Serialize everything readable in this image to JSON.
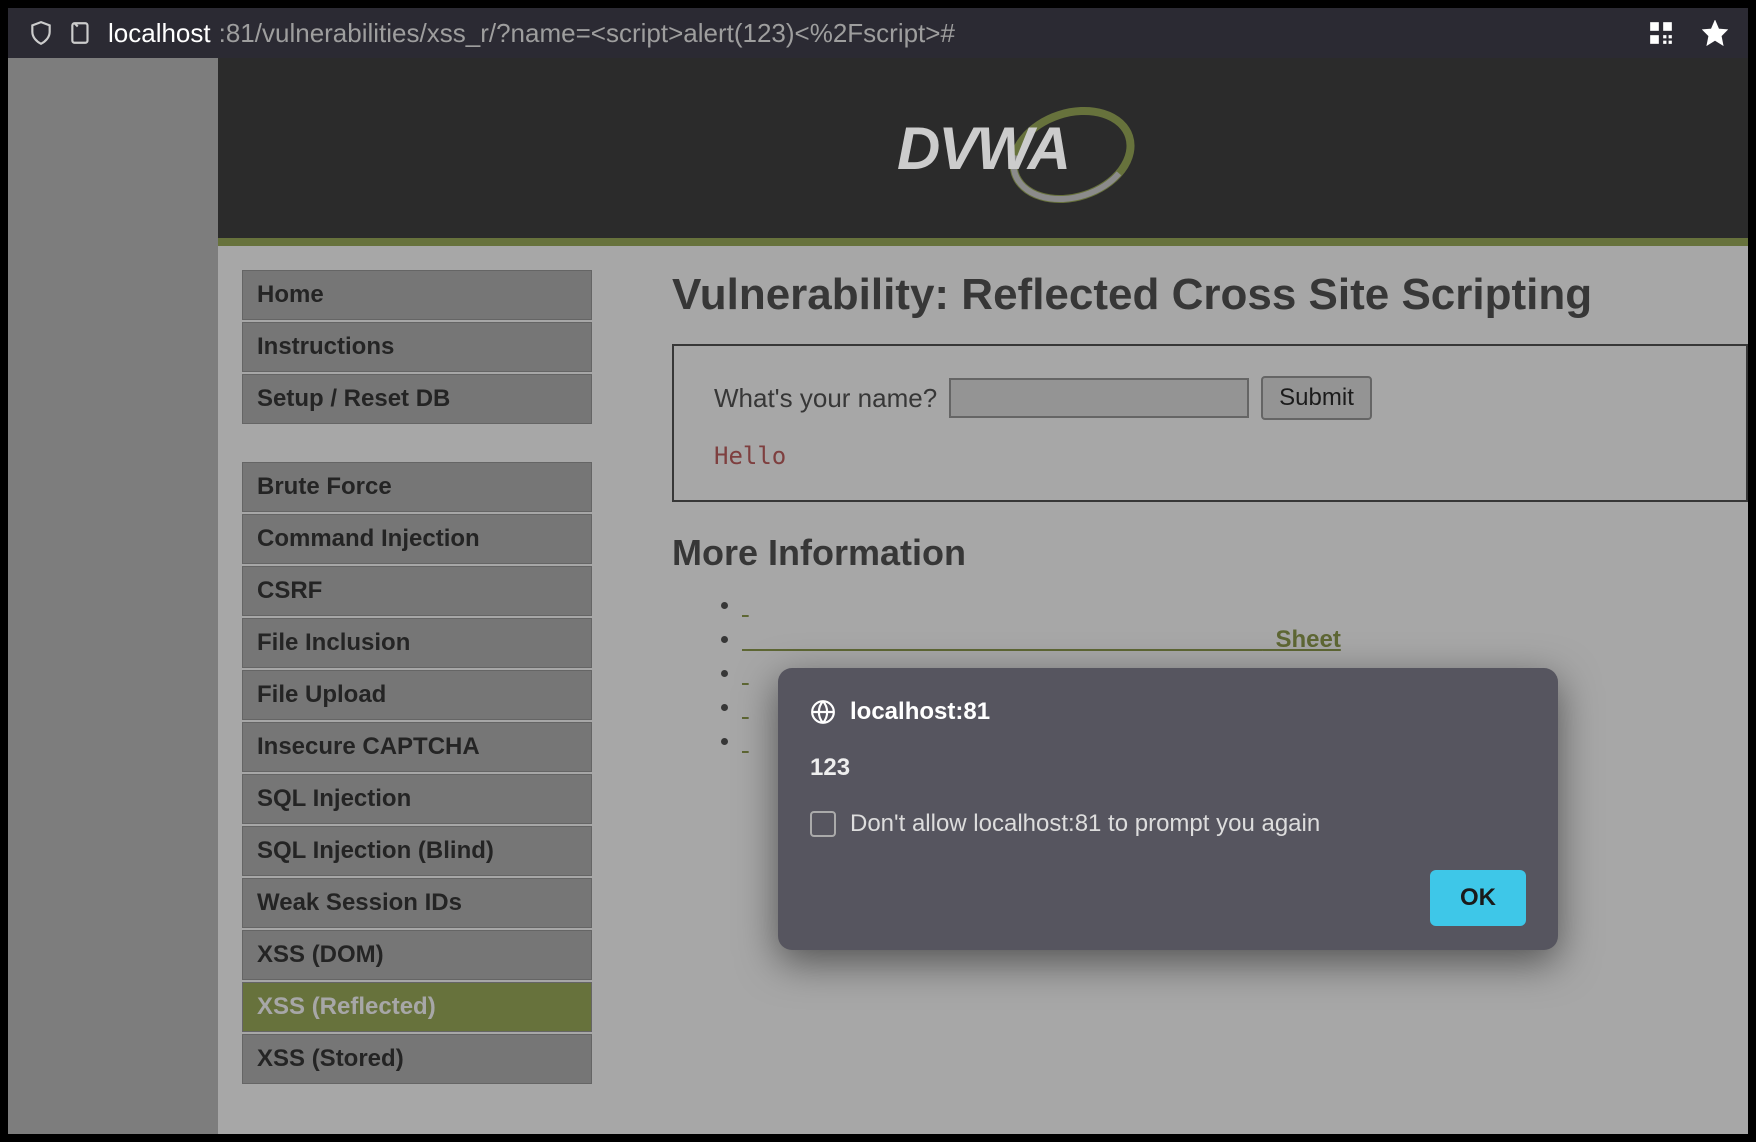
{
  "browser": {
    "url_host": "localhost",
    "url_rest": ":81/vulnerabilities/xss_r/?name=<script>alert(123)<%2Fscript>#"
  },
  "logo_text": "DVWA",
  "sidebar": {
    "group1": [
      {
        "label": "Home"
      },
      {
        "label": "Instructions"
      },
      {
        "label": "Setup / Reset DB"
      }
    ],
    "group2": [
      {
        "label": "Brute Force"
      },
      {
        "label": "Command Injection"
      },
      {
        "label": "CSRF"
      },
      {
        "label": "File Inclusion"
      },
      {
        "label": "File Upload"
      },
      {
        "label": "Insecure CAPTCHA"
      },
      {
        "label": "SQL Injection"
      },
      {
        "label": "SQL Injection (Blind)"
      },
      {
        "label": "Weak Session IDs"
      },
      {
        "label": "XSS (DOM)"
      },
      {
        "label": "XSS (Reflected)",
        "active": true
      },
      {
        "label": "XSS (Stored)"
      }
    ]
  },
  "main": {
    "title": "Vulnerability: Reflected Cross Site Scripting",
    "form_label": "What's your name?",
    "submit_label": "Submit",
    "output": "Hello",
    "more_info_heading": "More Information",
    "info_link_visible": "_Sheet"
  },
  "alert": {
    "origin": "localhost:81",
    "message": "123",
    "checkbox_label": "Don't allow localhost:81 to prompt you again",
    "ok_label": "OK"
  }
}
